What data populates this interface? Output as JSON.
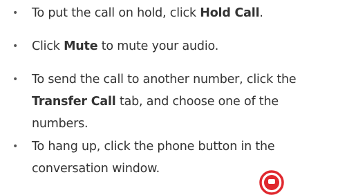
{
  "bullet_symbol": "•",
  "items": [
    {
      "before": "To put the call on hold, click ",
      "bold": "Hold Call",
      "after": "."
    },
    {
      "before": "Click ",
      "bold": "Mute",
      "after": " to mute your audio."
    },
    {
      "before": "To send the call to another number, click the ",
      "bold": "Transfer Call",
      "after": " tab, and choose one of the numbers."
    },
    {
      "text": "To hang up, click the phone button in the conversation window."
    }
  ],
  "icons": {
    "hangup": "phone-hangup-icon"
  },
  "colors": {
    "text": "#333333",
    "icon_red": "#e0282e"
  }
}
